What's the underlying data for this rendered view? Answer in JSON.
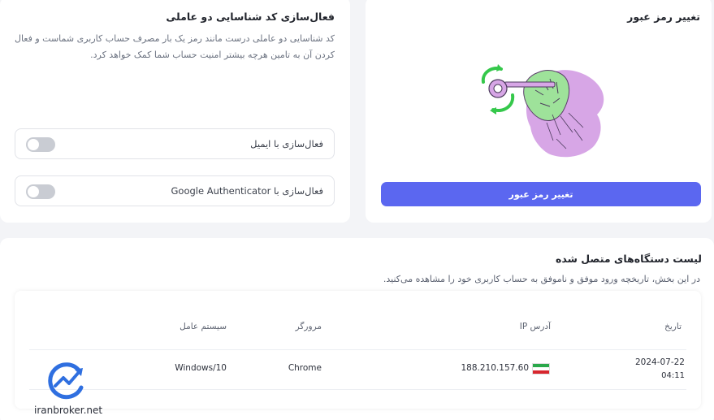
{
  "password_card": {
    "title": "تغییر رمز عبور",
    "button_label": "تغییر رمز عبور"
  },
  "two_factor_card": {
    "title": "فعال‌سازی کد شناسایی دو عاملی",
    "description": "کد شناسایی دو عاملی درست مانند رمز یک بار مصرف حساب کاربری شماست و فعال کردن آن به تامین هرچه بیشتر امنیت حساب شما کمک خواهد کرد.",
    "options": [
      {
        "label": "فعال‌سازی با ایمیل",
        "enabled": false
      },
      {
        "label": "فعال‌سازی با Google Authenticator",
        "enabled": false
      }
    ]
  },
  "devices_card": {
    "title": "لیست دستگاه‌های متصل شده",
    "description": "در این بخش، تاریخچه ورود موفق و ناموفق به حساب کاربری خود را مشاهده می‌کنید.",
    "columns": {
      "date": "تاریخ",
      "ip": "آدرس IP",
      "browser": "مرورگر",
      "os": "سیستم عامل"
    },
    "rows": [
      {
        "date": "2024-07-22",
        "time": "04:11",
        "ip": "188.210.157.60",
        "flag": "iran-flag",
        "browser": "Chrome",
        "os": "Windows/10"
      }
    ]
  },
  "watermark": {
    "text": "iranbroker.net"
  },
  "colors": {
    "accent": "#5b67f0",
    "illustration_green": "#9ee29a",
    "illustration_purple": "#d7a6e6",
    "icon_green": "#35c84b"
  }
}
